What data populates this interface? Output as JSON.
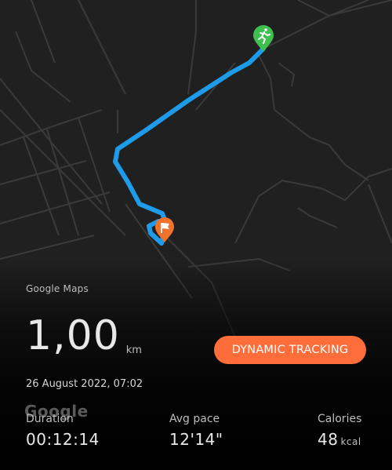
{
  "map": {
    "attribution": "Google Maps",
    "watermark": "Google",
    "route_color": "#1e9be9",
    "start_marker_color": "#3fbf4f",
    "end_marker_color": "#f0722f",
    "start_icon": "runner-icon",
    "end_icon": "flag-icon"
  },
  "summary": {
    "distance": "1,00",
    "distance_unit": "km",
    "datetime": "26 August 2022, 07:02",
    "dynamic_tracking_label": "DYNAMIC TRACKING",
    "accent_color": "#ff6d3a"
  },
  "stats": {
    "duration": {
      "label": "Duration",
      "value": "00:12:14"
    },
    "pace": {
      "label": "Avg pace",
      "value": "12'14\""
    },
    "calories": {
      "label": "Calories",
      "value": "48",
      "unit": "kcal"
    }
  }
}
